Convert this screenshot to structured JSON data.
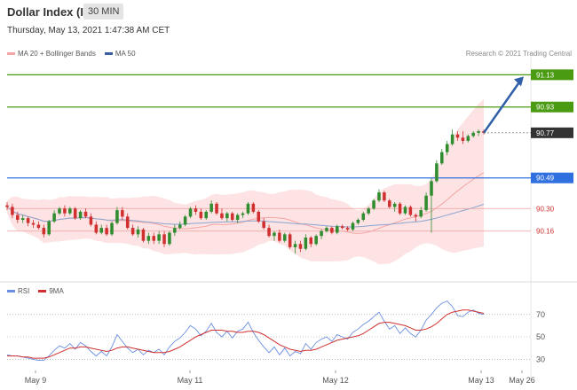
{
  "header": {
    "title": "Dollar Index (ICE)",
    "timeframe": "30 MIN",
    "datetime": "Thursday, May 13, 2021 1:47:38 AM CET"
  },
  "legend": {
    "bb": "MA 20 + Bollinger Bands",
    "ma50": "MA 50",
    "source": "Research © 2021 Trading Central"
  },
  "rsi_legend": {
    "rsi": "RSI",
    "ma": "9MA"
  },
  "colors": {
    "bb": "#f4a5a5",
    "ma50": "#3a5fa0",
    "green": "#4a9a12",
    "blue": "#2f6fe0",
    "dark": "#333333",
    "up": "#2f8c2f",
    "down": "#d03030"
  },
  "chart_data": {
    "type": "candlestick",
    "price_axis": {
      "ylim": [
        89.9,
        91.22
      ],
      "levels": [
        {
          "value": "91.13",
          "kind": "resistance-target",
          "color": "#4a9a12"
        },
        {
          "value": "90.93",
          "kind": "resistance",
          "color": "#4a9a12"
        },
        {
          "value": "90.77",
          "kind": "last-price",
          "color": "#333333"
        },
        {
          "value": "90.49",
          "kind": "pivot",
          "color": "#2f6fe0"
        },
        {
          "value": "90.30",
          "kind": "support",
          "color": "#e06060"
        },
        {
          "value": "90.16",
          "kind": "support",
          "color": "#e06060"
        }
      ]
    },
    "x_ticks": [
      "May 9",
      "May 11",
      "May 12",
      "May 13",
      "May 26"
    ],
    "candles": [
      [
        90.32,
        90.34,
        90.29,
        90.31
      ],
      [
        90.31,
        90.33,
        90.24,
        90.26
      ],
      [
        90.26,
        90.28,
        90.21,
        90.23
      ],
      [
        90.23,
        90.26,
        90.21,
        90.24
      ],
      [
        90.24,
        90.25,
        90.19,
        90.21
      ],
      [
        90.21,
        90.23,
        90.18,
        90.2
      ],
      [
        90.2,
        90.22,
        90.17,
        90.18
      ],
      [
        90.18,
        90.2,
        90.12,
        90.14
      ],
      [
        90.14,
        90.23,
        90.13,
        90.22
      ],
      [
        90.22,
        90.29,
        90.21,
        90.27
      ],
      [
        90.27,
        90.31,
        90.26,
        90.3
      ],
      [
        90.3,
        90.32,
        90.25,
        90.27
      ],
      [
        90.27,
        90.31,
        90.26,
        90.3
      ],
      [
        90.3,
        90.31,
        90.23,
        90.24
      ],
      [
        90.24,
        90.29,
        90.23,
        90.28
      ],
      [
        90.28,
        90.3,
        90.24,
        90.25
      ],
      [
        90.25,
        90.27,
        90.19,
        90.2
      ],
      [
        90.2,
        90.22,
        90.14,
        90.15
      ],
      [
        90.15,
        90.2,
        90.14,
        90.18
      ],
      [
        90.18,
        90.2,
        90.13,
        90.14
      ],
      [
        90.14,
        90.22,
        90.13,
        90.21
      ],
      [
        90.21,
        90.31,
        90.2,
        90.29
      ],
      [
        90.29,
        90.31,
        90.23,
        90.25
      ],
      [
        90.25,
        90.27,
        90.17,
        90.18
      ],
      [
        90.18,
        90.2,
        90.13,
        90.14
      ],
      [
        90.14,
        90.19,
        90.12,
        90.17
      ],
      [
        90.17,
        90.18,
        90.09,
        90.1
      ],
      [
        90.1,
        90.15,
        90.08,
        90.13
      ],
      [
        90.13,
        90.15,
        90.08,
        90.1
      ],
      [
        90.1,
        90.16,
        90.08,
        90.14
      ],
      [
        90.14,
        90.16,
        90.06,
        90.08
      ],
      [
        90.08,
        90.16,
        90.07,
        90.15
      ],
      [
        90.15,
        90.2,
        90.13,
        90.18
      ],
      [
        90.18,
        90.22,
        90.17,
        90.2
      ],
      [
        90.2,
        90.26,
        90.19,
        90.25
      ],
      [
        90.25,
        90.31,
        90.24,
        90.3
      ],
      [
        90.3,
        90.32,
        90.26,
        90.28
      ],
      [
        90.28,
        90.3,
        90.23,
        90.24
      ],
      [
        90.24,
        90.29,
        90.23,
        90.28
      ],
      [
        90.28,
        90.35,
        90.27,
        90.33
      ],
      [
        90.33,
        90.34,
        90.26,
        90.27
      ],
      [
        90.27,
        90.3,
        90.23,
        90.24
      ],
      [
        90.24,
        90.28,
        90.22,
        90.27
      ],
      [
        90.27,
        90.28,
        90.22,
        90.23
      ],
      [
        90.23,
        90.27,
        90.21,
        90.26
      ],
      [
        90.26,
        90.28,
        90.24,
        90.27
      ],
      [
        90.27,
        90.34,
        90.26,
        90.33
      ],
      [
        90.33,
        90.34,
        90.27,
        90.28
      ],
      [
        90.28,
        90.29,
        90.21,
        90.22
      ],
      [
        90.22,
        90.24,
        90.17,
        90.18
      ],
      [
        90.18,
        90.2,
        90.12,
        90.13
      ],
      [
        90.13,
        90.16,
        90.1,
        90.15
      ],
      [
        90.15,
        90.17,
        90.09,
        90.1
      ],
      [
        90.1,
        90.15,
        90.09,
        90.14
      ],
      [
        90.14,
        90.15,
        90.05,
        90.06
      ],
      [
        90.06,
        90.1,
        90.02,
        90.08
      ],
      [
        90.08,
        90.1,
        90.03,
        90.05
      ],
      [
        90.05,
        90.14,
        90.04,
        90.12
      ],
      [
        90.12,
        90.13,
        90.06,
        90.08
      ],
      [
        90.08,
        90.14,
        90.07,
        90.13
      ],
      [
        90.13,
        90.17,
        90.11,
        90.16
      ],
      [
        90.16,
        90.19,
        90.15,
        90.18
      ],
      [
        90.18,
        90.19,
        90.14,
        90.15
      ],
      [
        90.15,
        90.2,
        90.14,
        90.19
      ],
      [
        90.19,
        90.2,
        90.17,
        90.18
      ],
      [
        90.18,
        90.19,
        90.16,
        90.17
      ],
      [
        90.17,
        90.22,
        90.16,
        90.21
      ],
      [
        90.21,
        90.24,
        90.2,
        90.23
      ],
      [
        90.23,
        90.28,
        90.22,
        90.27
      ],
      [
        90.27,
        90.31,
        90.26,
        90.3
      ],
      [
        90.3,
        90.36,
        90.29,
        90.35
      ],
      [
        90.35,
        90.42,
        90.34,
        90.4
      ],
      [
        90.4,
        90.41,
        90.34,
        90.35
      ],
      [
        90.35,
        90.36,
        90.3,
        90.31
      ],
      [
        90.31,
        90.34,
        90.28,
        90.33
      ],
      [
        90.33,
        90.34,
        90.26,
        90.27
      ],
      [
        90.27,
        90.32,
        90.26,
        90.31
      ],
      [
        90.31,
        90.32,
        90.25,
        90.26
      ],
      [
        90.26,
        90.27,
        90.22,
        90.25
      ],
      [
        90.25,
        90.31,
        90.24,
        90.29
      ],
      [
        90.29,
        90.4,
        90.28,
        90.38
      ],
      [
        90.38,
        90.49,
        90.15,
        90.47
      ],
      [
        90.47,
        90.6,
        90.46,
        90.58
      ],
      [
        90.58,
        90.67,
        90.57,
        90.65
      ],
      [
        90.65,
        90.72,
        90.63,
        90.7
      ],
      [
        90.7,
        90.79,
        90.69,
        90.76
      ],
      [
        90.76,
        90.78,
        90.72,
        90.74
      ],
      [
        90.74,
        90.78,
        90.7,
        90.72
      ],
      [
        90.72,
        90.76,
        90.71,
        90.75
      ],
      [
        90.75,
        90.78,
        90.74,
        90.77
      ],
      [
        90.77,
        90.79,
        90.75,
        90.78
      ],
      [
        90.78,
        90.79,
        90.76,
        90.77
      ]
    ],
    "rsi_axis": {
      "ylim": [
        20,
        88
      ],
      "ticks": [
        30,
        50,
        70
      ]
    },
    "rsi": [
      34,
      33,
      33,
      32,
      31,
      30,
      29,
      29,
      33,
      38,
      42,
      40,
      44,
      39,
      45,
      42,
      37,
      33,
      37,
      33,
      41,
      52,
      46,
      40,
      36,
      39,
      34,
      38,
      36,
      39,
      34,
      41,
      46,
      49,
      54,
      60,
      57,
      51,
      55,
      62,
      54,
      50,
      55,
      49,
      55,
      57,
      63,
      54,
      47,
      41,
      36,
      41,
      34,
      40,
      33,
      37,
      35,
      44,
      39,
      45,
      48,
      50,
      46,
      52,
      50,
      48,
      54,
      57,
      61,
      64,
      68,
      72,
      64,
      57,
      60,
      53,
      58,
      53,
      50,
      56,
      65,
      70,
      76,
      80,
      82,
      77,
      69,
      68,
      72,
      74,
      71,
      70
    ],
    "rsi_ma": [
      33,
      33,
      33,
      32,
      32,
      31,
      31,
      31,
      32,
      34,
      36,
      38,
      40,
      40,
      41,
      41,
      40,
      39,
      38,
      37,
      38,
      40,
      41,
      41,
      40,
      39,
      38,
      37,
      36,
      36,
      36,
      37,
      39,
      41,
      44,
      47,
      50,
      52,
      54,
      56,
      56,
      56,
      55,
      55,
      54,
      54,
      55,
      55,
      54,
      52,
      49,
      46,
      43,
      41,
      39,
      38,
      37,
      38,
      38,
      39,
      41,
      43,
      45,
      47,
      48,
      49,
      50,
      51,
      53,
      56,
      59,
      62,
      63,
      63,
      62,
      61,
      60,
      58,
      56,
      56,
      57,
      59,
      62,
      66,
      70,
      72,
      73,
      74,
      74,
      73,
      72,
      71
    ]
  }
}
